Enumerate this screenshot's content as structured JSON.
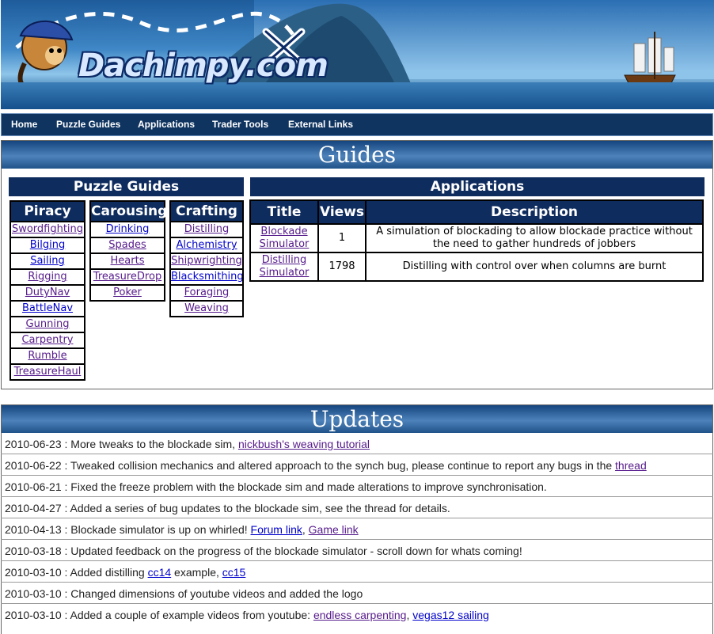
{
  "banner": {
    "logo_text": "Dachimpy.com"
  },
  "nav": {
    "items": [
      "Home",
      "Puzzle Guides",
      "Applications",
      "Trader Tools",
      "External Links"
    ]
  },
  "guides": {
    "title": "Guides",
    "puzzle_guides_title": "Puzzle Guides",
    "applications_title": "Applications",
    "piracy": {
      "title": "Piracy",
      "items": [
        "Swordfighting",
        "Bilging",
        "Sailing",
        "Rigging",
        "DutyNav",
        "BattleNav",
        "Gunning",
        "Carpentry",
        "Rumble",
        "TreasureHaul"
      ]
    },
    "carousing": {
      "title": "Carousing",
      "items": [
        "Drinking",
        "Spades",
        "Hearts",
        "TreasureDrop",
        "Poker"
      ]
    },
    "crafting": {
      "title": "Crafting",
      "items": [
        "Distilling",
        "Alchemistry",
        "Shipwrighting",
        "Blacksmithing",
        "Foraging",
        "Weaving"
      ]
    },
    "apps_table": {
      "headers": [
        "Title",
        "Views",
        "Description"
      ],
      "rows": [
        {
          "title": "Blockade Simulator",
          "views": "1",
          "description": "A simulation of blockading to allow blockade practice without the need to gather hundreds of jobbers"
        },
        {
          "title": "Distilling Simulator",
          "views": "1798",
          "description": "Distilling with control over when columns are burnt"
        }
      ]
    }
  },
  "updates": {
    "title": "Updates",
    "rows": [
      {
        "date": "2010-06-23",
        "text": " : More tweaks to the blockade sim, ",
        "links": [
          "nickbush's weaving tutorial"
        ]
      },
      {
        "date": "2010-06-22",
        "text": " : Tweaked collision mechanics and altered approach to the synch bug, please continue to report any bugs in the ",
        "links": [
          "thread"
        ]
      },
      {
        "date": "2010-06-21",
        "text": " : Fixed the freeze problem with the blockade sim and made alterations to improve synchronisation.",
        "links": []
      },
      {
        "date": "2010-04-27",
        "text": " : Added a series of bug updates to the blockade sim, see the thread for details.",
        "links": []
      },
      {
        "date": "2010-04-13",
        "text": " : Blockade simulator is up on whirled! ",
        "links": [
          "Forum link",
          "Game link"
        ]
      },
      {
        "date": "2010-03-18",
        "text": " : Updated feedback on the progress of the blockade simulator - scroll down for whats coming!",
        "links": []
      },
      {
        "date": "2010-03-10",
        "text": " : Added distilling ",
        "links": [
          "cc14",
          "cc15"
        ],
        "between": " example, "
      },
      {
        "date": "2010-03-10",
        "text": " : Changed dimensions of youtube videos and added the logo",
        "links": []
      },
      {
        "date": "2010-03-10",
        "text": " : Added a couple of example videos from youtube: ",
        "links": [
          "endless carpenting",
          "vegas12 sailing"
        ]
      }
    ]
  }
}
